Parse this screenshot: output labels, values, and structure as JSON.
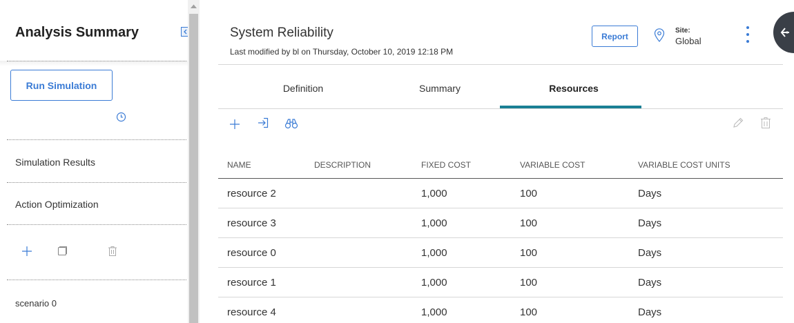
{
  "left_panel": {
    "title": "Analysis Summary",
    "run_button": "Run Simulation",
    "nav": [
      {
        "label": "Simulation Results"
      },
      {
        "label": "Action Optimization"
      }
    ],
    "scenario": "scenario 0"
  },
  "header": {
    "title": "System Reliability",
    "subtitle": "Last modified by bl on Thursday, October 10, 2019 12:18 PM",
    "report_button": "Report",
    "site_label": "Site:",
    "site_value": "Global"
  },
  "tabs": [
    {
      "label": "Definition",
      "active": false
    },
    {
      "label": "Summary",
      "active": false
    },
    {
      "label": "Resources",
      "active": true
    }
  ],
  "table": {
    "columns": [
      "NAME",
      "DESCRIPTION",
      "FIXED COST",
      "VARIABLE COST",
      "VARIABLE COST UNITS"
    ],
    "rows": [
      {
        "name": "resource 2",
        "description": "",
        "fixed_cost": "1,000",
        "variable_cost": "100",
        "units": "Days"
      },
      {
        "name": "resource 3",
        "description": "",
        "fixed_cost": "1,000",
        "variable_cost": "100",
        "units": "Days"
      },
      {
        "name": "resource 0",
        "description": "",
        "fixed_cost": "1,000",
        "variable_cost": "100",
        "units": "Days"
      },
      {
        "name": "resource 1",
        "description": "",
        "fixed_cost": "1,000",
        "variable_cost": "100",
        "units": "Days"
      },
      {
        "name": "resource 4",
        "description": "",
        "fixed_cost": "1,000",
        "variable_cost": "100",
        "units": "Days"
      }
    ]
  },
  "colors": {
    "accent": "#3a7bd5",
    "tab_active": "#1a7f94",
    "side_tab": "#3a3f47"
  },
  "icons": [
    "clock-icon",
    "plus-icon",
    "copy-icon",
    "trash-icon",
    "import-icon",
    "binoculars-icon",
    "pencil-icon",
    "location-pin-icon",
    "kebab-menu-icon",
    "collapse-left-icon"
  ]
}
